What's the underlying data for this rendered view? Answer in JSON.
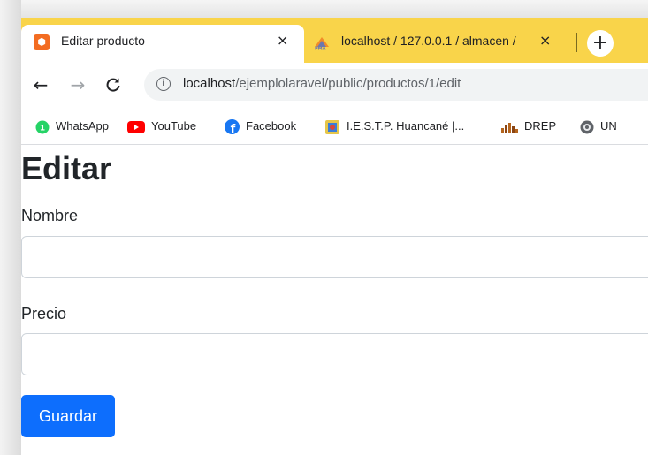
{
  "browser": {
    "tabs": [
      {
        "title": "Editar producto",
        "active": true,
        "icon": "laravel-icon"
      },
      {
        "title": "localhost / 127.0.0.1 / almacen /",
        "active": false,
        "icon": "phpmyadmin-icon"
      }
    ],
    "new_tab_label": "+",
    "close_label": "×",
    "url": {
      "host": "localhost",
      "path": "/ejemplolaravel/public/productos/1/edit"
    },
    "bookmarks": [
      {
        "label": "WhatsApp",
        "icon": "whatsapp-icon",
        "color": "#25d366"
      },
      {
        "label": "YouTube",
        "icon": "youtube-icon",
        "color": "#ff0000"
      },
      {
        "label": "Facebook",
        "icon": "facebook-icon",
        "color": "#1877f2"
      },
      {
        "label": "I.E.S.T.P. Huancané |...",
        "icon": "school-icon",
        "color": "#3b7dd8"
      },
      {
        "label": "DREP",
        "icon": "drep-icon",
        "color": "#b5651d"
      },
      {
        "label": "UN",
        "icon": "globe-icon",
        "color": "#5f6368"
      }
    ]
  },
  "page": {
    "title": "Editar",
    "fields": [
      {
        "label": "Nombre",
        "value": "",
        "placeholder": ""
      },
      {
        "label": "Precio",
        "value": "",
        "placeholder": ""
      }
    ],
    "submit_label": "Guardar"
  },
  "colors": {
    "tabstrip": "#f9d44a",
    "primary_button": "#0d6efd"
  }
}
